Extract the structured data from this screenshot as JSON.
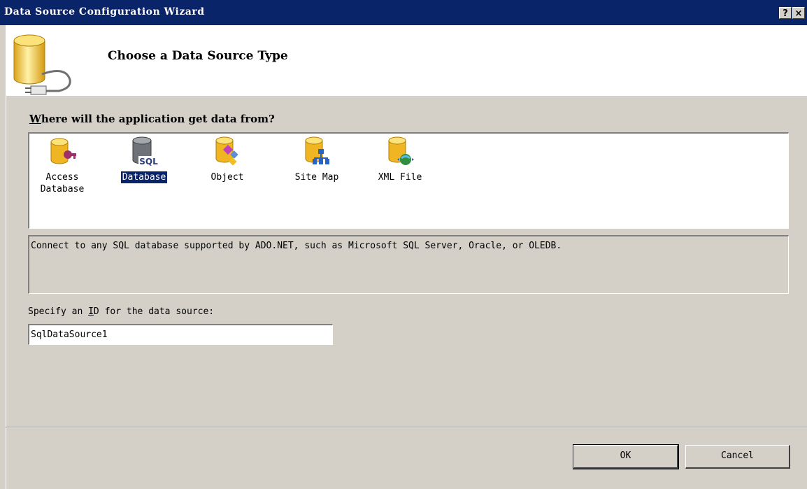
{
  "window": {
    "title": "Data Source Configuration Wizard",
    "help_button": "?",
    "close_button": "×"
  },
  "header": {
    "heading": "Choose a Data Source Type",
    "icon": "database-plug-icon"
  },
  "question": {
    "accel": "W",
    "rest": "here will the application get data from?"
  },
  "data_source_types": [
    {
      "label_line1": "Access",
      "label_line2": "Database",
      "icon": "access-database-icon",
      "selected": false
    },
    {
      "label_line1": "Database",
      "label_line2": "",
      "icon": "sql-database-icon",
      "selected": true
    },
    {
      "label_line1": "Object",
      "label_line2": "",
      "icon": "object-icon",
      "selected": false
    },
    {
      "label_line1": "Site Map",
      "label_line2": "",
      "icon": "site-map-icon",
      "selected": false
    },
    {
      "label_line1": "XML File",
      "label_line2": "",
      "icon": "xml-file-icon",
      "selected": false
    }
  ],
  "description": "Connect to any SQL database supported by ADO.NET, such as Microsoft SQL Server, Oracle, or OLEDB.",
  "id_field": {
    "label_before": "Specify an ",
    "label_accel": "I",
    "label_after": "D for the data source:",
    "value": "SqlDataSource1"
  },
  "buttons": {
    "ok": "OK",
    "cancel": "Cancel"
  },
  "colors": {
    "titlebar": "#0a246a",
    "dialog_bg": "#d4d0c8",
    "selection": "#0a246a",
    "db_gold": "#f2c233"
  }
}
